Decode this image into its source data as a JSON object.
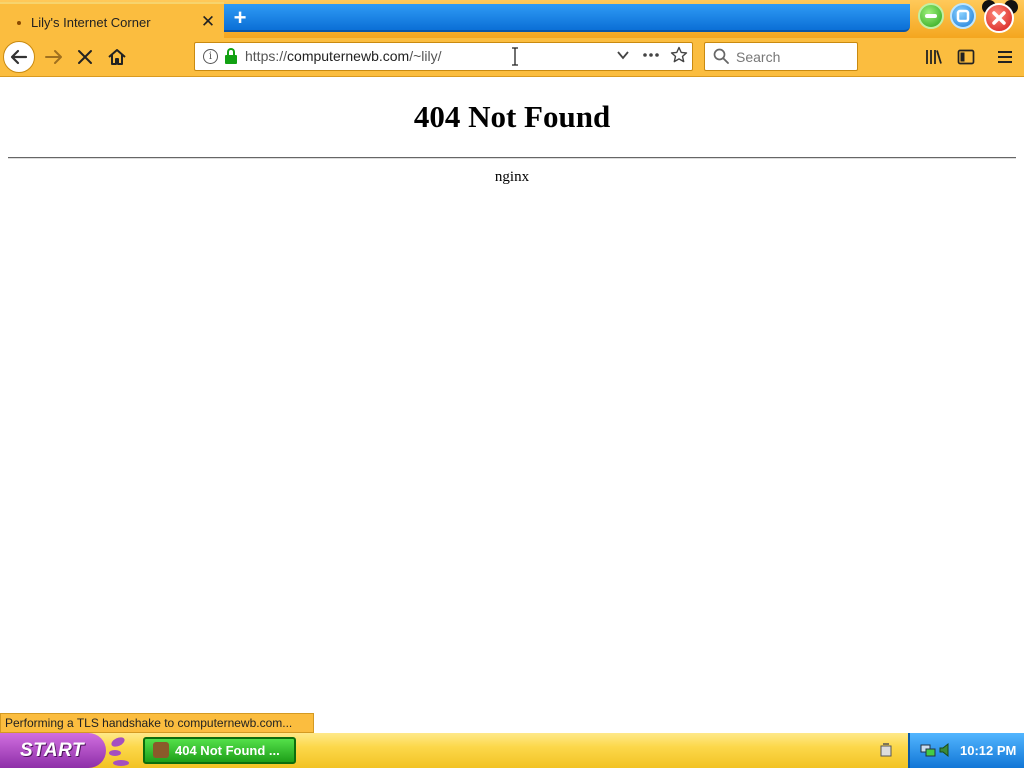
{
  "browser": {
    "tab_title": "Lily's Internet Corner",
    "tab_close": "✕",
    "new_tab": "+",
    "url_prefix": "https://",
    "url_domain": "computernewb.com",
    "url_path": "/~lily/",
    "search_placeholder": "Search",
    "status_text": "Performing a TLS handshake to computernewb.com...",
    "icons": {
      "back": "back-arrow-icon",
      "forward": "forward-arrow-icon",
      "stop": "stop-icon",
      "home": "home-icon",
      "info": "info-icon",
      "lock": "lock-icon",
      "dropdown": "chevron-down-icon",
      "more": "more-icon",
      "bookmark": "star-icon",
      "library": "library-icon",
      "sidebar": "sidebar-icon",
      "menu": "hamburger-menu-icon"
    }
  },
  "page": {
    "title": "404 Not Found",
    "server": "nginx"
  },
  "taskbar": {
    "start_label": "START",
    "task_label": "404 Not Found ...",
    "clock": "10:12 PM"
  },
  "colors": {
    "chrome_orange": "#fbbd3f",
    "tab_blue": "#0b6fd6",
    "start_purple": "#8e2fa8",
    "task_green": "#1e9f19",
    "tray_blue": "#1176d6"
  }
}
